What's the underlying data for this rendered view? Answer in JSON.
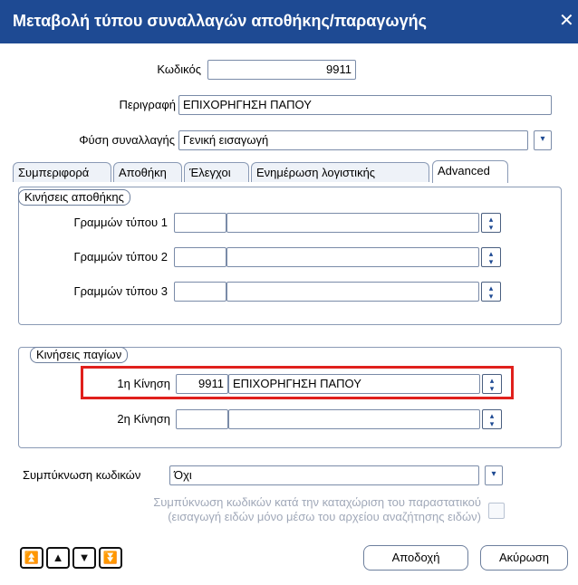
{
  "window": {
    "title": "Μεταβολή τύπου συναλλαγών αποθήκης/παραγωγής",
    "close_glyph": "✕"
  },
  "header": {
    "code_label": "Κωδικός",
    "code_value": "9911",
    "description_label": "Περιγραφή",
    "description_value": "ΕΠΙΧΟΡΗΓΗΣΗ ΠΑΠΟΥ",
    "nature_label": "Φύση συναλλαγής",
    "nature_value": "Γενική εισαγωγή"
  },
  "tabs": [
    {
      "label": "Συμπεριφορά"
    },
    {
      "label": "Αποθήκη"
    },
    {
      "label": "Έλεγχοι"
    },
    {
      "label": "Ενημέρωση λογιστικής"
    },
    {
      "label": "Advanced"
    }
  ],
  "warehouse_moves": {
    "title": "Κινήσεις αποθήκης",
    "rows": [
      {
        "label": "Γραμμών τύπου 1",
        "code": "",
        "description": ""
      },
      {
        "label": "Γραμμών τύπου 2",
        "code": "",
        "description": ""
      },
      {
        "label": "Γραμμών τύπου 3",
        "code": "",
        "description": ""
      }
    ]
  },
  "asset_moves": {
    "title": "Κινήσεις παγίων",
    "rows": [
      {
        "label": "1η Κίνηση",
        "code": "9911",
        "description": "ΕΠΙΧΟΡΗΓΗΣΗ ΠΑΠΟΥ"
      },
      {
        "label": "2η Κίνηση",
        "code": "",
        "description": ""
      }
    ]
  },
  "compression": {
    "label": "Συμπύκνωση κωδικών",
    "value": "Όχι",
    "option_line1": "Συμπύκνωση κωδικών κατά την καταχώριση του παραστατικού",
    "option_line2": "(εισαγωγή ειδών μόνο μέσω του αρχείου αναζήτησης ειδών)"
  },
  "footer": {
    "accept_label": "Αποδοχή",
    "cancel_label": "Ακύρωση",
    "nav_first_glyph": "⏫",
    "nav_prev_glyph": "▲",
    "nav_next_glyph": "▼",
    "nav_last_glyph": "⏬"
  },
  "icons": {
    "combo_arrow": "▾",
    "spin_up": "▴",
    "spin_down": "▾"
  },
  "colors": {
    "titlebar": "#1e4a93",
    "highlight": "#e0201c"
  }
}
